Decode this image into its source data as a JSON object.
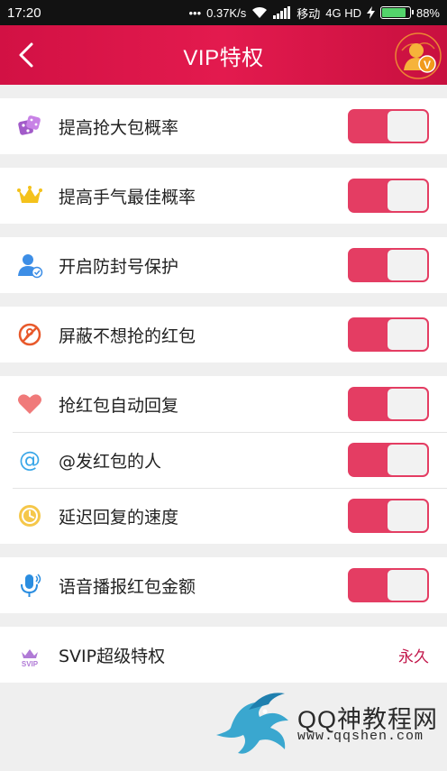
{
  "status_bar": {
    "time": "17:20",
    "speed": "0.37K/s",
    "carrier": "移动",
    "network": "4G HD",
    "battery": "88%",
    "battery_level": 0.88
  },
  "header": {
    "title": "VIP特权",
    "back_icon": "chevron-left-icon",
    "avatar_icon": "user-avatar-icon"
  },
  "groups": [
    {
      "rows": [
        {
          "label": "提高抢大包概率",
          "icon": "dice-icon",
          "toggle_on": true
        }
      ]
    },
    {
      "rows": [
        {
          "label": "提高手气最佳概率",
          "icon": "crown-icon",
          "toggle_on": true
        }
      ]
    },
    {
      "rows": [
        {
          "label": "开启防封号保护",
          "icon": "user-protect-icon",
          "toggle_on": true
        }
      ]
    },
    {
      "rows": [
        {
          "label": "屏蔽不想抢的红包",
          "icon": "block-icon",
          "toggle_on": true
        }
      ]
    },
    {
      "rows": [
        {
          "label": "抢红包自动回复",
          "icon": "heart-icon",
          "toggle_on": true
        },
        {
          "label": "@发红包的人",
          "icon": "at-icon",
          "toggle_on": true
        },
        {
          "label": "延迟回复的速度",
          "icon": "clock-icon",
          "toggle_on": true
        }
      ]
    },
    {
      "rows": [
        {
          "label": "语音播报红包金额",
          "icon": "microphone-icon",
          "toggle_on": true
        }
      ]
    },
    {
      "rows": [
        {
          "label": "SVIP超级特权",
          "icon": "svip-icon",
          "value": "永久"
        }
      ]
    }
  ],
  "watermark": {
    "text": "QQ神教程网",
    "url": "www.qqshen.com"
  },
  "colors": {
    "accent": "#e43d63",
    "header": "#d21144",
    "value_text": "#c2164a"
  }
}
